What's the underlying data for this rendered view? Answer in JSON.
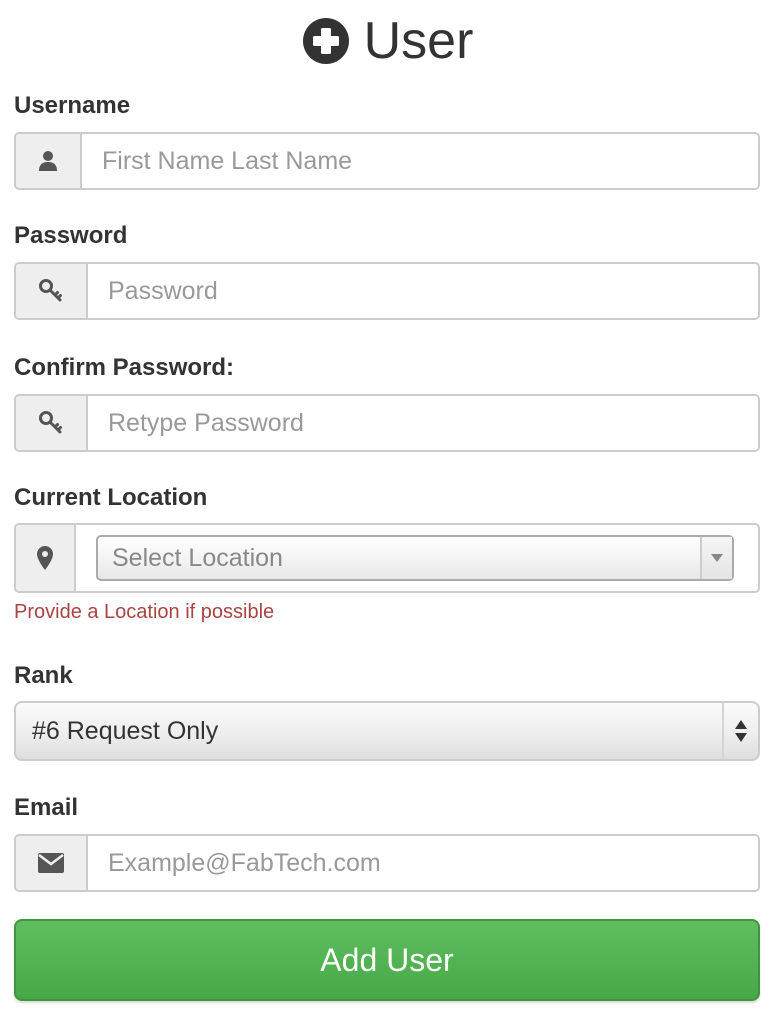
{
  "header": {
    "icon": "plus-circle-icon",
    "title": "User"
  },
  "form": {
    "username": {
      "label": "Username",
      "icon": "user-icon",
      "placeholder": "First Name Last Name",
      "value": ""
    },
    "password": {
      "label": "Password",
      "icon": "key-icon",
      "placeholder": "Password",
      "value": ""
    },
    "confirm_password": {
      "label": "Confirm Password:",
      "icon": "key-icon",
      "placeholder": "Retype Password",
      "value": ""
    },
    "location": {
      "label": "Current Location",
      "icon": "map-marker-icon",
      "selected": "Select Location",
      "help": "Provide a Location if possible"
    },
    "rank": {
      "label": "Rank",
      "selected": "#6 Request Only"
    },
    "email": {
      "label": "Email",
      "icon": "envelope-icon",
      "placeholder": "Example@FabTech.com",
      "value": ""
    },
    "submit_label": "Add User"
  },
  "colors": {
    "text": "#333333",
    "placeholder": "#999999",
    "help_text": "#a94442",
    "addon_bg": "#eeeeee",
    "border": "#cccccc",
    "success": "#5cb85c"
  }
}
